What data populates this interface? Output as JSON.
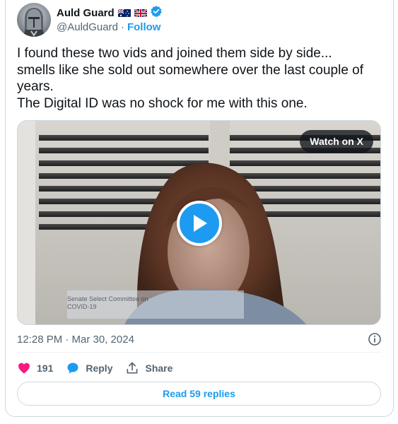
{
  "author": {
    "display_name": "Auld Guard",
    "handle": "@AuldGuard",
    "follow_label": "Follow",
    "separator": "·",
    "flags": [
      "australia-flag",
      "uk-flag"
    ],
    "verified_color": "#1d9bf0"
  },
  "tweet": {
    "text": "I found these two vids and joined them side by side...\nsmells like she sold out somewhere over the last couple of years.\nThe Digital ID was no shock for me with this one."
  },
  "media": {
    "watch_label": "Watch on X",
    "caption_line1": "Senate Select Committee on",
    "caption_line2": "COVID-19",
    "play_color": "#1d9bf0"
  },
  "meta": {
    "timestamp": "12:28 PM · Mar 30, 2024"
  },
  "actions": {
    "like_count": "191",
    "reply_label": "Reply",
    "share_label": "Share",
    "like_color": "#f91880",
    "reply_color": "#1d9bf0"
  },
  "read_replies_label": "Read 59 replies"
}
